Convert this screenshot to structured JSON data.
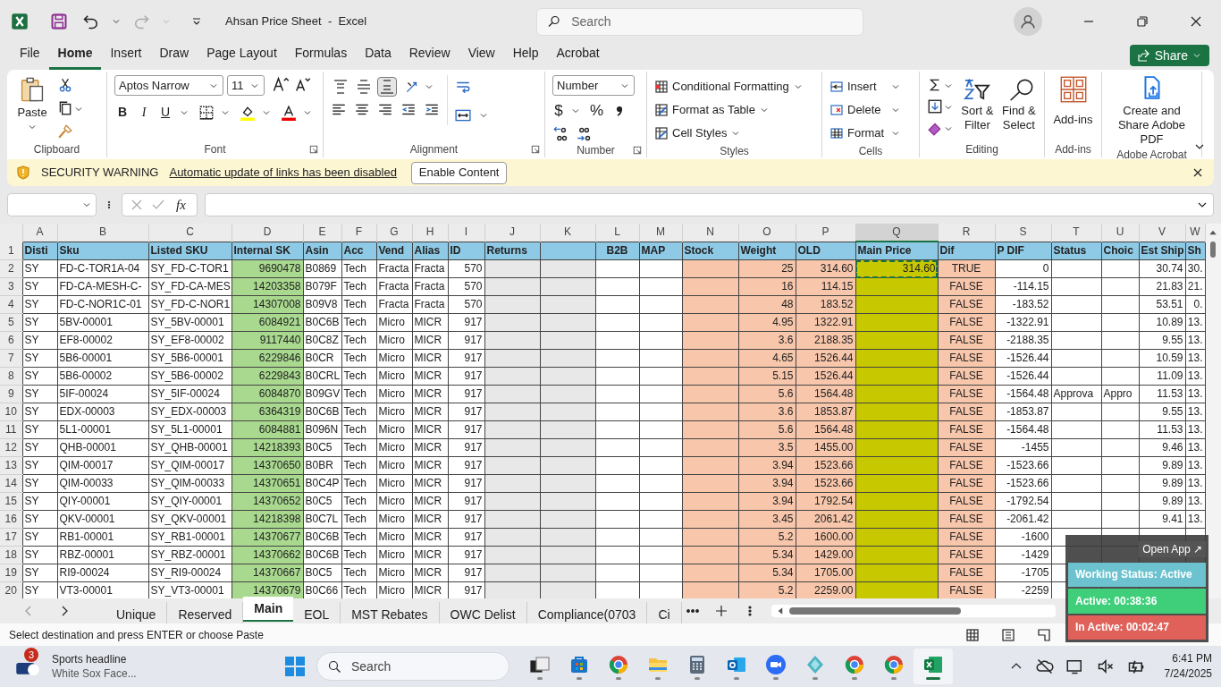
{
  "window": {
    "title": "Ahsan Price Sheet  -  Excel"
  },
  "search": {
    "placeholder": "Search"
  },
  "menu_tabs": [
    {
      "label": "File",
      "selected": false
    },
    {
      "label": "Home",
      "selected": true
    },
    {
      "label": "Insert",
      "selected": false
    },
    {
      "label": "Draw",
      "selected": false
    },
    {
      "label": "Page Layout",
      "selected": false
    },
    {
      "label": "Formulas",
      "selected": false
    },
    {
      "label": "Data",
      "selected": false
    },
    {
      "label": "Review",
      "selected": false
    },
    {
      "label": "View",
      "selected": false
    },
    {
      "label": "Help",
      "selected": false
    },
    {
      "label": "Acrobat",
      "selected": false
    }
  ],
  "share_button": {
    "label": "Share"
  },
  "ribbon": {
    "clipboard": {
      "paste": "Paste",
      "label": "Clipboard"
    },
    "font": {
      "name": "Aptos Narrow",
      "size": "11",
      "bold": "B",
      "italic": "I",
      "underline": "U",
      "label": "Font"
    },
    "alignment": {
      "label": "Alignment",
      "vertical": [
        {
          "selected": false
        },
        {
          "selected": false
        },
        {
          "selected": true
        }
      ]
    },
    "number": {
      "format": "Number",
      "currency": "$",
      "percent": "%",
      "label": "Number"
    },
    "styles": {
      "items": [
        "Conditional Formatting",
        "Format as Table",
        "Cell Styles"
      ],
      "label": "Styles"
    },
    "cells": {
      "items": [
        "Insert",
        "Delete",
        "Format"
      ],
      "label": "Cells"
    },
    "editing": {
      "sort": "Sort & Filter",
      "find": "Find & Select",
      "label": "Editing"
    },
    "addins": {
      "button": "Add-ins",
      "label": "Add-ins"
    },
    "acrobat": {
      "button": "Create and Share Adobe PDF",
      "label": "Adobe Acrobat"
    }
  },
  "security_bar": {
    "title": "SECURITY WARNING",
    "message": "Automatic update of links has been disabled",
    "button": "Enable Content"
  },
  "formula_bar": {
    "fx": "fx"
  },
  "sheet": {
    "columns": [
      {
        "letter": "A",
        "header": "Disti",
        "selected": false
      },
      {
        "letter": "B",
        "header": "Sku",
        "selected": false
      },
      {
        "letter": "C",
        "header": "Listed SKU",
        "selected": false
      },
      {
        "letter": "D",
        "header": "Internal SK",
        "selected": false,
        "color": "#a9d98f"
      },
      {
        "letter": "E",
        "header": "Asin",
        "selected": false
      },
      {
        "letter": "F",
        "header": "Acc",
        "selected": false
      },
      {
        "letter": "G",
        "header": "Vend",
        "selected": false
      },
      {
        "letter": "H",
        "header": "Alias",
        "selected": false
      },
      {
        "letter": "I",
        "header": "ID",
        "selected": false
      },
      {
        "letter": "J",
        "header": "Returns",
        "selected": false,
        "color": "#e8e8e8"
      },
      {
        "letter": "K",
        "selected": false,
        "color": "#e8e8e8"
      },
      {
        "letter": "L",
        "header": "B2B",
        "selected": false
      },
      {
        "letter": "M",
        "header": "MAP",
        "selected": false
      },
      {
        "letter": "N",
        "header": "Stock",
        "selected": false,
        "color": "#f7c6ab"
      },
      {
        "letter": "O",
        "header": "Weight",
        "selected": false,
        "color": "#f7c6ab"
      },
      {
        "letter": "P",
        "header": "OLD",
        "selected": false,
        "color": "#f7c6ab"
      },
      {
        "letter": "Q",
        "header": "Main Price",
        "selected": true,
        "color": "#c8c800"
      },
      {
        "letter": "R",
        "header": "Dif",
        "selected": false,
        "color": "#f7c6ab"
      },
      {
        "letter": "S",
        "header": "P DIF",
        "selected": false
      },
      {
        "letter": "T",
        "header": "Status",
        "selected": false
      },
      {
        "letter": "U",
        "header": "Choic",
        "selected": false
      },
      {
        "letter": "V",
        "header": "Est Ship",
        "selected": false
      },
      {
        "letter": "W",
        "header": "Sh",
        "selected": false
      }
    ],
    "header_row": "1",
    "rows": [
      {
        "number": "2",
        "copied": true,
        "cells": [
          "SY",
          "FD-C-TOR1A-04",
          "SY_FD-C-TOR1",
          "9690478",
          "B0869",
          "Tech",
          "Fracta",
          "Fracta",
          "570",
          null,
          null,
          null,
          null,
          null,
          "25",
          "314.60",
          "314.60",
          "TRUE",
          "0",
          null,
          null,
          "30.74",
          "30."
        ]
      },
      {
        "number": "3",
        "copied": false,
        "cells": [
          "SY",
          "FD-CA-MESH-C-",
          "SY_FD-CA-MES",
          "14203358",
          "B079F",
          "Tech",
          "Fracta",
          "Fracta",
          "570",
          null,
          null,
          null,
          null,
          null,
          "16",
          "114.15",
          null,
          "FALSE",
          "-114.15",
          null,
          null,
          "21.83",
          "21."
        ]
      },
      {
        "number": "4",
        "copied": false,
        "cells": [
          "SY",
          "FD-C-NOR1C-01",
          "SY_FD-C-NOR1",
          "14307008",
          "B09V8",
          "Tech",
          "Fracta",
          "Fracta",
          "570",
          null,
          null,
          null,
          null,
          null,
          "48",
          "183.52",
          null,
          "FALSE",
          "-183.52",
          null,
          null,
          "53.51",
          "0."
        ]
      },
      {
        "number": "5",
        "copied": false,
        "cells": [
          "SY",
          "5BV-00001",
          "SY_5BV-00001",
          "6084921",
          "B0C6B",
          "Tech",
          "Micro",
          "MICR",
          "917",
          null,
          null,
          null,
          null,
          null,
          "4.95",
          "1322.91",
          null,
          "FALSE",
          "-1322.91",
          null,
          null,
          "10.89",
          "13."
        ]
      },
      {
        "number": "6",
        "copied": false,
        "cells": [
          "SY",
          "EF8-00002",
          "SY_EF8-00002",
          "9117440",
          "B0C8Z",
          "Tech",
          "Micro",
          "MICR",
          "917",
          null,
          null,
          null,
          null,
          null,
          "3.6",
          "2188.35",
          null,
          "FALSE",
          "-2188.35",
          null,
          null,
          "9.55",
          "13."
        ]
      },
      {
        "number": "7",
        "copied": false,
        "cells": [
          "SY",
          "5B6-00001",
          "SY_5B6-00001",
          "6229846",
          "B0CR",
          "Tech",
          "Micro",
          "MICR",
          "917",
          null,
          null,
          null,
          null,
          null,
          "4.65",
          "1526.44",
          null,
          "FALSE",
          "-1526.44",
          null,
          null,
          "10.59",
          "13."
        ]
      },
      {
        "number": "8",
        "copied": false,
        "cells": [
          "SY",
          "5B6-00002",
          "SY_5B6-00002",
          "6229843",
          "B0CRL",
          "Tech",
          "Micro",
          "MICR",
          "917",
          null,
          null,
          null,
          null,
          null,
          "5.15",
          "1526.44",
          null,
          "FALSE",
          "-1526.44",
          null,
          null,
          "11.09",
          "13."
        ]
      },
      {
        "number": "9",
        "copied": false,
        "cells": [
          "SY",
          "5IF-00024",
          "SY_5IF-00024",
          "6084870",
          "B09GV",
          "Tech",
          "Micro",
          "MICR",
          "917",
          null,
          null,
          null,
          null,
          null,
          "5.6",
          "1564.48",
          null,
          "FALSE",
          "-1564.48",
          "Approva",
          "Appro",
          "11.53",
          "13."
        ]
      },
      {
        "number": "10",
        "copied": false,
        "cells": [
          "SY",
          "EDX-00003",
          "SY_EDX-00003",
          "6364319",
          "B0C6B",
          "Tech",
          "Micro",
          "MICR",
          "917",
          null,
          null,
          null,
          null,
          null,
          "3.6",
          "1853.87",
          null,
          "FALSE",
          "-1853.87",
          null,
          null,
          "9.55",
          "13."
        ]
      },
      {
        "number": "11",
        "copied": false,
        "cells": [
          "SY",
          "5L1-00001",
          "SY_5L1-00001",
          "6084881",
          "B096N",
          "Tech",
          "Micro",
          "MICR",
          "917",
          null,
          null,
          null,
          null,
          null,
          "5.6",
          "1564.48",
          null,
          "FALSE",
          "-1564.48",
          null,
          null,
          "11.53",
          "13."
        ]
      },
      {
        "number": "12",
        "copied": false,
        "cells": [
          "SY",
          "QHB-00001",
          "SY_QHB-00001",
          "14218393",
          "B0C5",
          "Tech",
          "Micro",
          "MICR",
          "917",
          null,
          null,
          null,
          null,
          null,
          "3.5",
          "1455.00",
          null,
          "FALSE",
          "-1455",
          null,
          null,
          "9.46",
          "13."
        ]
      },
      {
        "number": "13",
        "copied": false,
        "cells": [
          "SY",
          "QIM-00017",
          "SY_QIM-00017",
          "14370650",
          "B0BR",
          "Tech",
          "Micro",
          "MICR",
          "917",
          null,
          null,
          null,
          null,
          null,
          "3.94",
          "1523.66",
          null,
          "FALSE",
          "-1523.66",
          null,
          null,
          "9.89",
          "13."
        ]
      },
      {
        "number": "14",
        "copied": false,
        "cells": [
          "SY",
          "QIM-00033",
          "SY_QIM-00033",
          "14370651",
          "B0C4P",
          "Tech",
          "Micro",
          "MICR",
          "917",
          null,
          null,
          null,
          null,
          null,
          "3.94",
          "1523.66",
          null,
          "FALSE",
          "-1523.66",
          null,
          null,
          "9.89",
          "13."
        ]
      },
      {
        "number": "15",
        "copied": false,
        "cells": [
          "SY",
          "QIY-00001",
          "SY_QIY-00001",
          "14370652",
          "B0C5",
          "Tech",
          "Micro",
          "MICR",
          "917",
          null,
          null,
          null,
          null,
          null,
          "3.94",
          "1792.54",
          null,
          "FALSE",
          "-1792.54",
          null,
          null,
          "9.89",
          "13."
        ]
      },
      {
        "number": "16",
        "copied": false,
        "cells": [
          "SY",
          "QKV-00001",
          "SY_QKV-00001",
          "14218398",
          "B0C7L",
          "Tech",
          "Micro",
          "MICR",
          "917",
          null,
          null,
          null,
          null,
          null,
          "3.45",
          "2061.42",
          null,
          "FALSE",
          "-2061.42",
          null,
          null,
          "9.41",
          "13."
        ]
      },
      {
        "number": "17",
        "copied": false,
        "cells": [
          "SY",
          "RB1-00001",
          "SY_RB1-00001",
          "14370677",
          "B0C6B",
          "Tech",
          "Micro",
          "MICR",
          "917",
          null,
          null,
          null,
          null,
          null,
          "5.2",
          "1600.00",
          null,
          "FALSE",
          "-1600",
          null,
          null,
          null,
          null
        ]
      },
      {
        "number": "18",
        "copied": false,
        "cells": [
          "SY",
          "RBZ-00001",
          "SY_RBZ-00001",
          "14370662",
          "B0C6B",
          "Tech",
          "Micro",
          "MICR",
          "917",
          null,
          null,
          null,
          null,
          null,
          "5.34",
          "1429.00",
          null,
          "FALSE",
          "-1429",
          null,
          null,
          null,
          null
        ]
      },
      {
        "number": "19",
        "copied": false,
        "cells": [
          "SY",
          "RI9-00024",
          "SY_RI9-00024",
          "14370667",
          "B0C5",
          "Tech",
          "Micro",
          "MICR",
          "917",
          null,
          null,
          null,
          null,
          null,
          "5.34",
          "1705.00",
          null,
          "FALSE",
          "-1705",
          null,
          null,
          null,
          null
        ]
      },
      {
        "number": "20",
        "copied": false,
        "cells": [
          "SY",
          "VT3-00001",
          "SY_VT3-00001",
          "14370679",
          "B0C66",
          "Tech",
          "Micro",
          "MICR",
          "917",
          null,
          null,
          null,
          null,
          null,
          "5.2",
          "2259.00",
          null,
          "FALSE",
          "-2259",
          null,
          null,
          null,
          null
        ]
      }
    ]
  },
  "sheet_tabs": [
    {
      "label": "Unique",
      "selected": false
    },
    {
      "label": "Reserved",
      "selected": false
    },
    {
      "label": "Main",
      "selected": true
    },
    {
      "label": "EOL",
      "selected": false
    },
    {
      "label": "MST Rebates",
      "selected": false
    },
    {
      "label": "OWC Delist",
      "selected": false
    },
    {
      "label": "Compliance(0703",
      "selected": false
    },
    {
      "label": "Ci",
      "selected": false
    }
  ],
  "status_bar": {
    "message": "Select destination and press ENTER or choose Paste"
  },
  "tracker": {
    "open_app": "Open App ↗",
    "status": "Working Status: Active",
    "active": "Active: 00:38:36",
    "inactive": "In Active: 00:02:47"
  },
  "taskbar": {
    "news": {
      "badge": "3",
      "title": "Sports headline",
      "subtitle": "White Sox Face..."
    },
    "search": {
      "placeholder": "Search"
    },
    "apps": [
      {
        "kind": "taskview",
        "active": false
      },
      {
        "kind": "store",
        "active": false
      },
      {
        "kind": "chrome",
        "active": false
      },
      {
        "kind": "folder",
        "active": false
      },
      {
        "kind": "calculator",
        "active": false
      },
      {
        "kind": "outlook",
        "active": false
      },
      {
        "kind": "zoom",
        "active": false
      },
      {
        "kind": "gem",
        "active": false
      },
      {
        "kind": "chrome",
        "active": false
      },
      {
        "kind": "chrome",
        "active": false
      },
      {
        "kind": "excel",
        "active": true
      }
    ],
    "time": "6:41 PM",
    "date": "7/24/2025"
  }
}
